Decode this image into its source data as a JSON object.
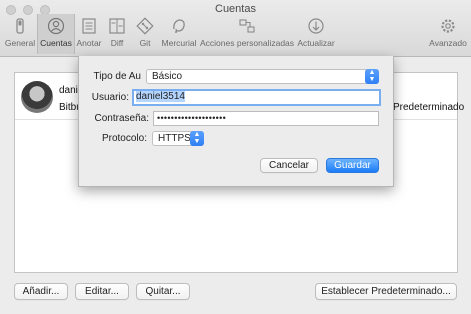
{
  "window": {
    "title": "Cuentas"
  },
  "toolbar": {
    "items": [
      {
        "label": "General",
        "icon": "switch-icon"
      },
      {
        "label": "Cuentas",
        "icon": "user-icon",
        "active": true
      },
      {
        "label": "Anotar",
        "icon": "document-icon"
      },
      {
        "label": "Diff",
        "icon": "diff-icon"
      },
      {
        "label": "Git",
        "icon": "git-icon"
      },
      {
        "label": "Mercurial",
        "icon": "mercurial-icon"
      },
      {
        "label": "Acciones personalizadas",
        "icon": "custom-actions-icon"
      },
      {
        "label": "Actualizar",
        "icon": "update-icon"
      },
      {
        "label": "Avanzado",
        "icon": "gear-icon"
      }
    ]
  },
  "account": {
    "name": "danie",
    "host": "Bitbu",
    "default_label": "Predeterminado"
  },
  "buttons": {
    "add": "Añadir...",
    "edit": "Editar...",
    "remove": "Quitar...",
    "set_default": "Establecer Predeterminado..."
  },
  "dialog": {
    "auth_type_label": "Tipo de Au",
    "auth_type_value": "Básico",
    "username_label": "Usuario:",
    "username_value": "daniel3514",
    "password_label": "Contraseña:",
    "password_value": "••••••••••••••••••••",
    "protocol_label": "Protocolo:",
    "protocol_value": "HTTPS",
    "cancel": "Cancelar",
    "save": "Guardar"
  },
  "colors": {
    "accent": "#2f7ff5",
    "focus_ring": "#79aef0",
    "selection": "#b4d5fe"
  }
}
